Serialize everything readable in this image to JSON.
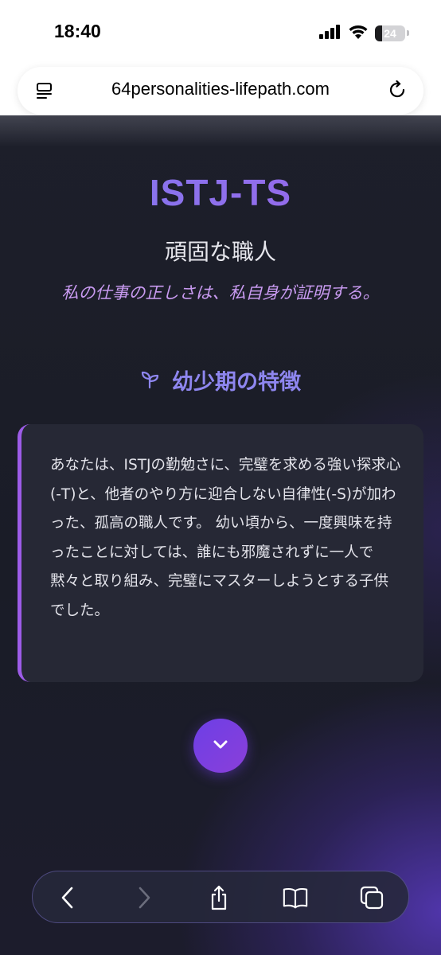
{
  "status_bar": {
    "time": "18:40",
    "battery_level": "24",
    "battery_fraction": 0.24,
    "icons": [
      "signal-icon",
      "wifi-icon",
      "battery-icon"
    ]
  },
  "browser": {
    "url": "64personalities-lifepath.com",
    "icons": [
      "page-menu-icon",
      "reload-icon"
    ]
  },
  "hero": {
    "title": "ISTJ-TS",
    "subtitle": "頑固な職人",
    "quote": "私の仕事の正しさは、私自身が証明する。"
  },
  "section": {
    "icon": "sprout-icon",
    "title": "幼少期の特徴"
  },
  "card": {
    "text": "あなたは、ISTJの勤勉さに、完璧を求める強い探求心(-T)と、他者のやり方に迎合しない自律性(-S)が加わった、孤高の職人です。 幼い頃から、一度興味を持ったことに対しては、誰にも邪魔されずに一人で黙々と取り組み、完璧にマスターしようとする子供でした。"
  },
  "scroll_button": {
    "icon": "chevron-down-icon"
  },
  "toolbar": {
    "icons": [
      "back-icon",
      "forward-icon",
      "share-icon",
      "bookmarks-icon",
      "tabs-icon"
    ]
  },
  "colors": {
    "title_gradient_start": "#7f7cf0",
    "title_gradient_end": "#9d63e8",
    "quote": "#c89af0",
    "section_title": "#8e86ef",
    "card_accent": "#9d5ce8",
    "background": "#1a1c27"
  }
}
